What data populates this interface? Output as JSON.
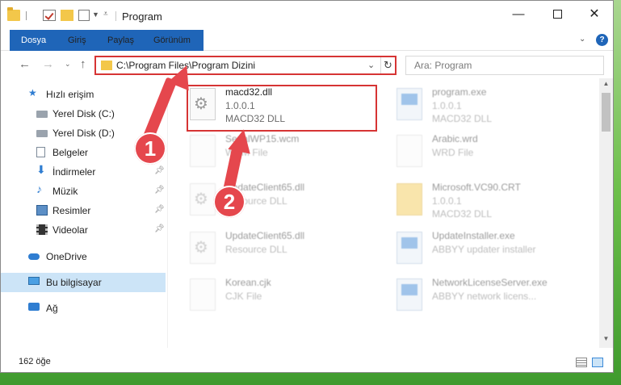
{
  "window": {
    "title": "Program",
    "controls": {
      "minimize": "—",
      "close": "✕"
    }
  },
  "ribbon": {
    "tabs": [
      {
        "label": "Dosya"
      },
      {
        "label": "Giriş"
      },
      {
        "label": "Paylaş"
      },
      {
        "label": "Görünüm"
      }
    ],
    "help": "?"
  },
  "nav": {
    "back": "←",
    "forward": "→",
    "up": "↑",
    "address": "C:\\Program Files\\Program Dizini",
    "search_placeholder": "Ara: Program"
  },
  "sidebar": {
    "items": [
      {
        "label": "Hızlı erişim"
      },
      {
        "label": "Yerel Disk (C:)"
      },
      {
        "label": "Yerel Disk (D:)"
      },
      {
        "label": "Belgeler"
      },
      {
        "label": "İndirmeler"
      },
      {
        "label": "Müzik"
      },
      {
        "label": "Resimler"
      },
      {
        "label": "Videolar"
      },
      {
        "label": "OneDrive"
      },
      {
        "label": "Bu bilgisayar"
      },
      {
        "label": "Ağ"
      }
    ]
  },
  "files": [
    {
      "name": "macd32.dll",
      "line1": "1.0.0.1",
      "line2": "MACD32 DLL"
    },
    {
      "name": "program.exe",
      "line1": "1.0.0.1",
      "line2": "MACD32 DLL"
    },
    {
      "name": "SerialWP15.wcm",
      "line1": "WCM File",
      "line2": ""
    },
    {
      "name": "Arabic.wrd",
      "line1": "WRD File",
      "line2": ""
    },
    {
      "name": "UpdateClient65.dll",
      "line1": "Resource DLL",
      "line2": ""
    },
    {
      "name": "Microsoft.VC90.CRT",
      "line1": "1.0.0.1",
      "line2": "MACD32 DLL"
    },
    {
      "name": "UpdateClient65.dll",
      "line1": "Resource DLL",
      "line2": ""
    },
    {
      "name": "UpdateInstaller.exe",
      "line1": "ABBYY updater installer",
      "line2": ""
    },
    {
      "name": "Korean.cjk",
      "line1": "CJK File",
      "line2": ""
    },
    {
      "name": "NetworkLicenseServer.exe",
      "line1": "ABBYY network licens...",
      "line2": ""
    }
  ],
  "status": {
    "count": "162 öğe"
  },
  "annotations": {
    "badge1": "1",
    "badge2": "2"
  },
  "colors": {
    "accent": "#1f65b8",
    "highlight": "#d63434",
    "annotation": "#e5474d",
    "selected": "#cce4f7"
  }
}
